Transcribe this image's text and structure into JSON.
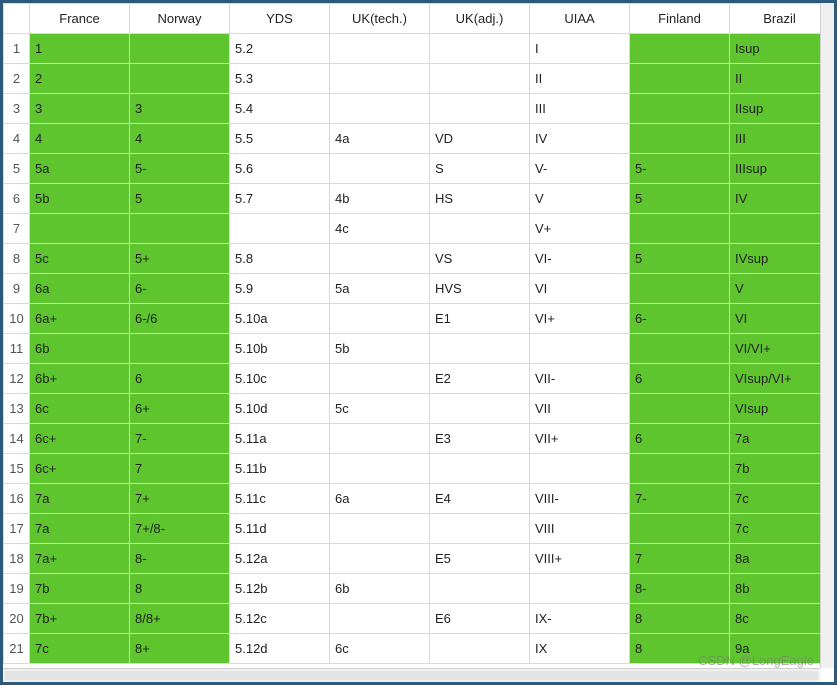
{
  "watermark": "CSDN @LongEagle",
  "columns": [
    "France",
    "Norway",
    "YDS",
    "UK(tech.)",
    "UK(adj.)",
    "UIAA",
    "Finland",
    "Brazil"
  ],
  "green_columns": [
    "France",
    "Norway",
    "Finland",
    "Brazil"
  ],
  "rows": [
    {
      "n": 1,
      "France": "1",
      "Norway": "",
      "YDS": "5.2",
      "UK(tech.)": "",
      "UK(adj.)": "",
      "UIAA": "I",
      "Finland": "",
      "Brazil": "Isup"
    },
    {
      "n": 2,
      "France": "2",
      "Norway": "",
      "YDS": "5.3",
      "UK(tech.)": "",
      "UK(adj.)": "",
      "UIAA": "II",
      "Finland": "",
      "Brazil": "II"
    },
    {
      "n": 3,
      "France": "3",
      "Norway": "3",
      "YDS": "5.4",
      "UK(tech.)": "",
      "UK(adj.)": "",
      "UIAA": "III",
      "Finland": "",
      "Brazil": "IIsup"
    },
    {
      "n": 4,
      "France": "4",
      "Norway": "4",
      "YDS": "5.5",
      "UK(tech.)": "4a",
      "UK(adj.)": "VD",
      "UIAA": "IV",
      "Finland": "",
      "Brazil": "III"
    },
    {
      "n": 5,
      "France": "5a",
      "Norway": "5-",
      "YDS": "5.6",
      "UK(tech.)": "",
      "UK(adj.)": "S",
      "UIAA": "V-",
      "Finland": "5-",
      "Brazil": "IIIsup"
    },
    {
      "n": 6,
      "France": "5b",
      "Norway": "5",
      "YDS": "5.7",
      "UK(tech.)": "4b",
      "UK(adj.)": "HS",
      "UIAA": "V",
      "Finland": "5",
      "Brazil": "IV"
    },
    {
      "n": 7,
      "France": "",
      "Norway": "",
      "YDS": "",
      "UK(tech.)": "4c",
      "UK(adj.)": "",
      "UIAA": "V+",
      "Finland": "",
      "Brazil": ""
    },
    {
      "n": 8,
      "France": "5c",
      "Norway": "5+",
      "YDS": "5.8",
      "UK(tech.)": "",
      "UK(adj.)": "VS",
      "UIAA": "VI-",
      "Finland": "5",
      "Brazil": "IVsup"
    },
    {
      "n": 9,
      "France": "6a",
      "Norway": "6-",
      "YDS": "5.9",
      "UK(tech.)": "5a",
      "UK(adj.)": "HVS",
      "UIAA": "VI",
      "Finland": "",
      "Brazil": "V"
    },
    {
      "n": 10,
      "France": "6a+",
      "Norway": "6-/6",
      "YDS": "5.10a",
      "UK(tech.)": "",
      "UK(adj.)": "E1",
      "UIAA": "VI+",
      "Finland": "6-",
      "Brazil": "VI"
    },
    {
      "n": 11,
      "France": "6b",
      "Norway": "",
      "YDS": "5.10b",
      "UK(tech.)": "5b",
      "UK(adj.)": "",
      "UIAA": "",
      "Finland": "",
      "Brazil": "VI/VI+"
    },
    {
      "n": 12,
      "France": "6b+",
      "Norway": "6",
      "YDS": "5.10c",
      "UK(tech.)": "",
      "UK(adj.)": "E2",
      "UIAA": "VII-",
      "Finland": "6",
      "Brazil": "VIsup/VI+"
    },
    {
      "n": 13,
      "France": "6c",
      "Norway": "6+",
      "YDS": "5.10d",
      "UK(tech.)": "5c",
      "UK(adj.)": "",
      "UIAA": "VII",
      "Finland": "",
      "Brazil": "VIsup"
    },
    {
      "n": 14,
      "France": "6c+",
      "Norway": "7-",
      "YDS": "5.11a",
      "UK(tech.)": "",
      "UK(adj.)": "E3",
      "UIAA": "VII+",
      "Finland": "6",
      "Brazil": "7a"
    },
    {
      "n": 15,
      "France": "6c+",
      "Norway": "7",
      "YDS": "5.11b",
      "UK(tech.)": "",
      "UK(adj.)": "",
      "UIAA": "",
      "Finland": "",
      "Brazil": "7b"
    },
    {
      "n": 16,
      "France": "7a",
      "Norway": "7+",
      "YDS": "5.11c",
      "UK(tech.)": "6a",
      "UK(adj.)": "E4",
      "UIAA": "VIII-",
      "Finland": "7-",
      "Brazil": "7c"
    },
    {
      "n": 17,
      "France": "7a",
      "Norway": "7+/8-",
      "YDS": "5.11d",
      "UK(tech.)": "",
      "UK(adj.)": "",
      "UIAA": "VIII",
      "Finland": "",
      "Brazil": "7c"
    },
    {
      "n": 18,
      "France": "7a+",
      "Norway": "8-",
      "YDS": "5.12a",
      "UK(tech.)": "",
      "UK(adj.)": "E5",
      "UIAA": "VIII+",
      "Finland": "7",
      "Brazil": "8a"
    },
    {
      "n": 19,
      "France": "7b",
      "Norway": "8",
      "YDS": "5.12b",
      "UK(tech.)": "6b",
      "UK(adj.)": "",
      "UIAA": "",
      "Finland": "8-",
      "Brazil": "8b"
    },
    {
      "n": 20,
      "France": "7b+",
      "Norway": "8/8+",
      "YDS": "5.12c",
      "UK(tech.)": "",
      "UK(adj.)": "E6",
      "UIAA": "IX-",
      "Finland": "8",
      "Brazil": "8c"
    },
    {
      "n": 21,
      "France": "7c",
      "Norway": "8+",
      "YDS": "5.12d",
      "UK(tech.)": "6c",
      "UK(adj.)": "",
      "UIAA": "IX",
      "Finland": "8",
      "Brazil": "9a"
    }
  ]
}
